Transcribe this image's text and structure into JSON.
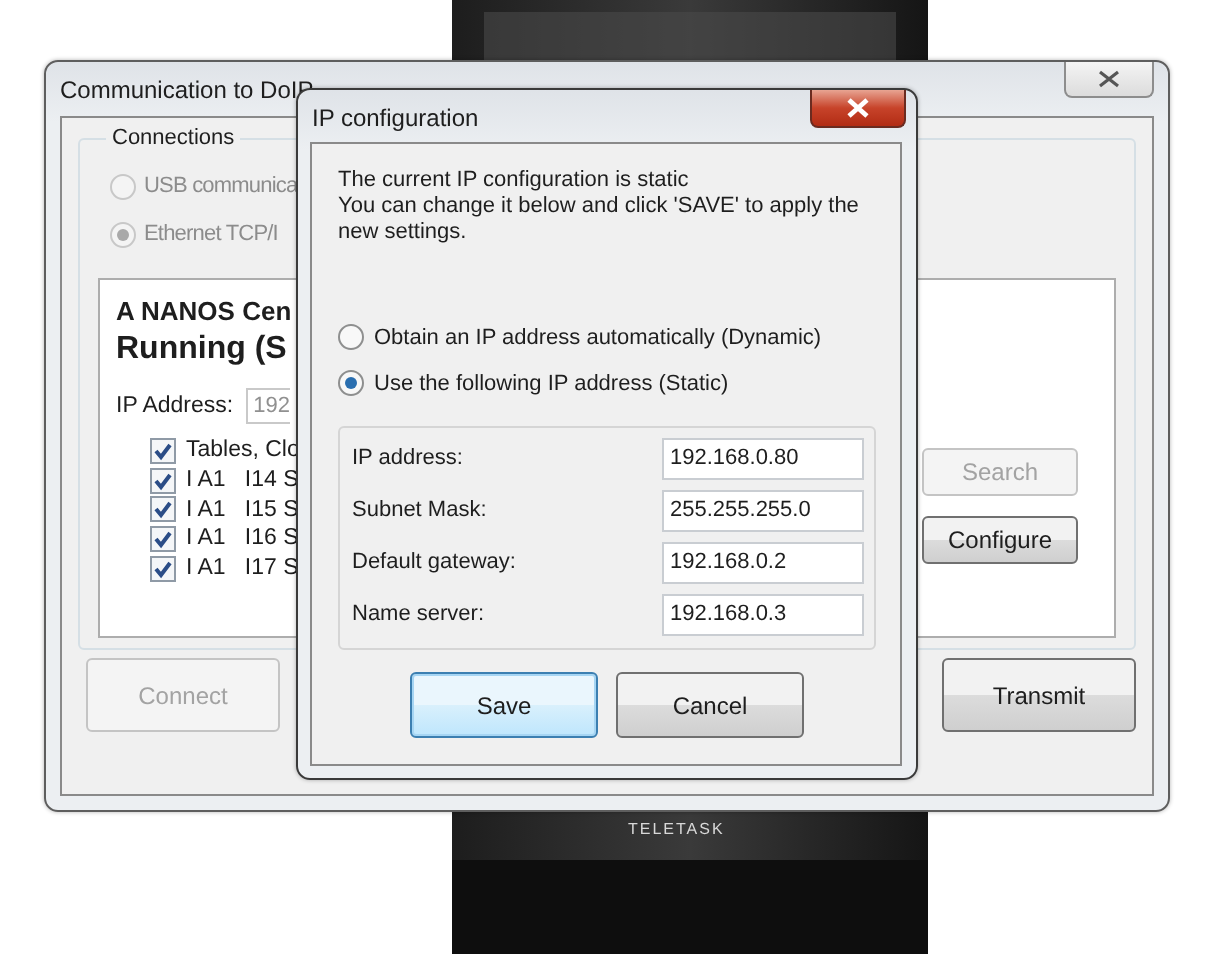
{
  "device": {
    "label": "TELETASK"
  },
  "main_window": {
    "title": "Communication to DoIP",
    "connections": {
      "title": "Connections",
      "options": [
        {
          "label": "USB communica",
          "selected": false,
          "disabled": true
        },
        {
          "label": "Ethernet TCP/I",
          "selected": true,
          "disabled": true
        }
      ]
    },
    "device_panel": {
      "name": "A NANOS Cen",
      "status": "Running (S",
      "ip_label": "IP Address:",
      "ip_value": "192",
      "items": [
        {
          "label": "Tables, Clo",
          "checked": true
        },
        {
          "label": "I A1   I14 S",
          "checked": true
        },
        {
          "label": "I A1   I15 S",
          "checked": true
        },
        {
          "label": "I A1   I16 S",
          "checked": true
        },
        {
          "label": "I A1   I17 S",
          "checked": true
        }
      ],
      "buttons": [
        {
          "label": "Search",
          "disabled": true
        },
        {
          "label": "Configure",
          "disabled": false
        }
      ]
    },
    "buttons": [
      {
        "label": "Connect",
        "disabled": true
      },
      {
        "label": "Transmit",
        "disabled": false
      }
    ]
  },
  "dialog": {
    "title": "IP configuration",
    "message_lines": [
      "The current IP configuration is static",
      "You can change it below and click 'SAVE' to apply the",
      "new settings."
    ],
    "modes": [
      {
        "label": "Obtain an IP address automatically (Dynamic)",
        "selected": false
      },
      {
        "label": "Use the following IP address (Static)",
        "selected": true
      }
    ],
    "fields": [
      {
        "label": "IP address:",
        "value": "192.168.0.80"
      },
      {
        "label": "Subnet Mask:",
        "value": "255.255.255.0"
      },
      {
        "label": "Default gateway:",
        "value": "192.168.0.2"
      },
      {
        "label": "Name server:",
        "value": "192.168.0.3"
      }
    ],
    "buttons": [
      {
        "label": "Save",
        "focused": true
      },
      {
        "label": "Cancel",
        "focused": false
      }
    ]
  }
}
